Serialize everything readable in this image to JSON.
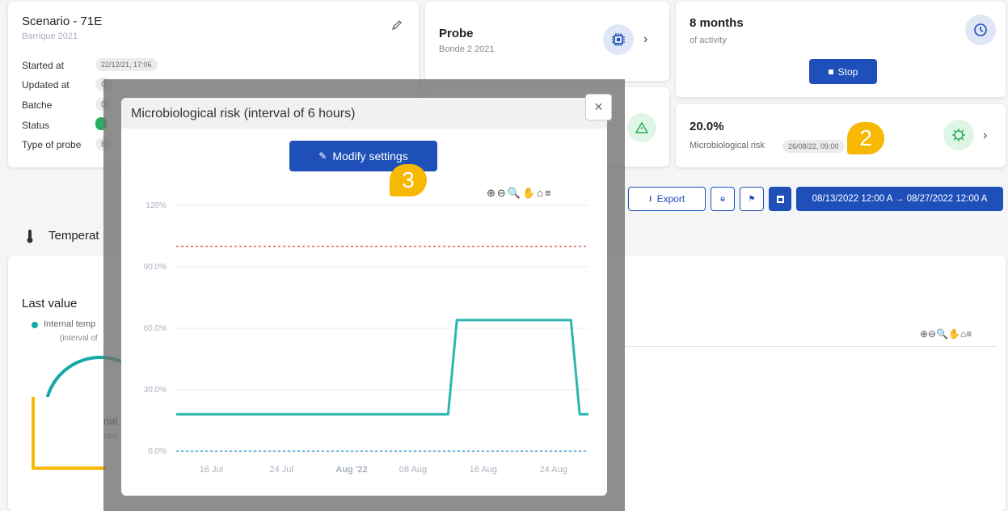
{
  "scenario": {
    "title": "Scenario - 71E",
    "subtitle": "Barrique 2021",
    "rows": [
      {
        "label": "Started at",
        "value": "22/12/21, 17:06"
      },
      {
        "label": "Updated at",
        "value": "C"
      },
      {
        "label": "Batche",
        "value": "D"
      },
      {
        "label": "Status",
        "value": ""
      },
      {
        "label": "Type of probe",
        "value": "E"
      }
    ]
  },
  "probe": {
    "title": "Probe",
    "subtitle": "Bonde 2 2021"
  },
  "activity": {
    "title": "8 months",
    "subtitle": "of activity",
    "stop_label": "Stop"
  },
  "risk": {
    "value": "20.0%",
    "label": "Microbiological risk",
    "timestamp": "26/08/22, 09:00"
  },
  "toolbar": {
    "export_label": "Export",
    "date_range": "08/13/2022 12:00 A → 08/27/2022 12:00 A"
  },
  "temperature": {
    "section_title": "Temperat",
    "last_value": "Last value",
    "legend_label": "Internal temp",
    "legend_sub": "(interval of",
    "fragment1": "nal",
    "fragment2": "nter"
  },
  "modal": {
    "title": "Microbiological risk (interval of 6 hours)",
    "modify_label": "Modify settings",
    "close_glyph": "×"
  },
  "badges": {
    "two": "2",
    "three": "3"
  },
  "colors": {
    "primary": "#1f4fb8",
    "teal": "#2bb7b0",
    "threshold": "#e06060",
    "baseline": "#4a9fd8",
    "badge": "#f6b800"
  },
  "chart_data": {
    "type": "line",
    "title": "",
    "xlabel": "",
    "ylabel": "",
    "ylim": [
      0,
      120
    ],
    "y_ticks": [
      "120%",
      "90.0%",
      "60.0%",
      "30.0%",
      "0.0%"
    ],
    "x_ticks": [
      "16 Jul",
      "24 Jul",
      "Aug '22",
      "08 Aug",
      "16 Aug",
      "24 Aug"
    ],
    "x_ticks_bold": [
      "Aug '22"
    ],
    "grid": true,
    "series": [
      {
        "points": [
          [
            "2022-07-12",
            18
          ],
          [
            "2022-08-12",
            18
          ],
          [
            "2022-08-13",
            64
          ],
          [
            "2022-08-26",
            64
          ],
          [
            "2022-08-27",
            18
          ],
          [
            "2022-08-28",
            18
          ]
        ]
      }
    ],
    "thresholds": [
      100,
      0
    ]
  }
}
